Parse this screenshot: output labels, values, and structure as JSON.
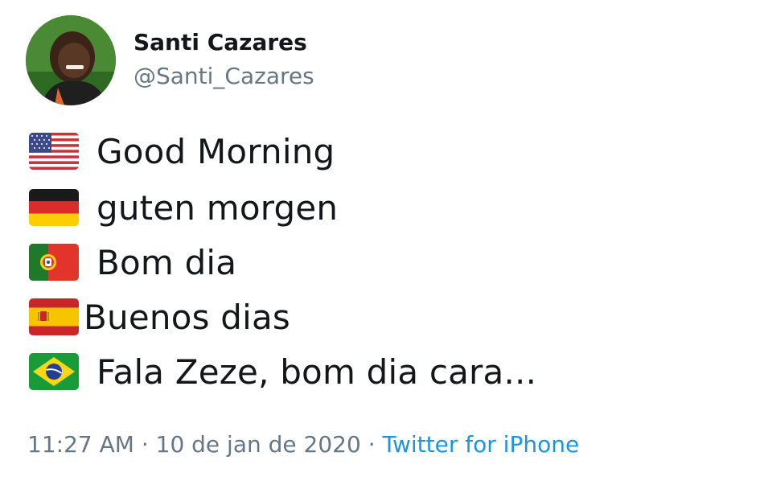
{
  "user": {
    "display_name": "Santi Cazares",
    "handle": "@Santi_Cazares",
    "avatar_icon": "profile-photo"
  },
  "lines": [
    {
      "flag_icon": "us-flag-icon",
      "text": "Good Morning"
    },
    {
      "flag_icon": "germany-flag-icon",
      "text": "guten morgen"
    },
    {
      "flag_icon": "portugal-flag-icon",
      "text": "Bom dia"
    },
    {
      "flag_icon": "spain-flag-icon",
      "text": "Buenos dias"
    },
    {
      "flag_icon": "brazil-flag-icon",
      "text": "Fala Zeze, bom dia cara..."
    }
  ],
  "meta": {
    "time": "11:27 AM",
    "date": "10 de jan de 2020",
    "separator": "·",
    "source": "Twitter for iPhone"
  },
  "colors": {
    "text": "#14171a",
    "secondary": "#657786",
    "link": "#1b95e0"
  }
}
